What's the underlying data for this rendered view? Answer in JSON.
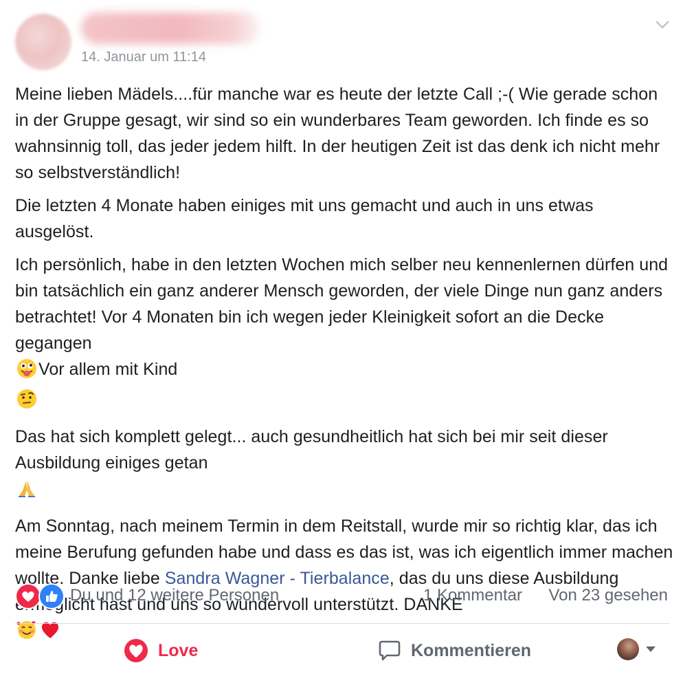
{
  "post": {
    "author_name": "",
    "timestamp": "14. Januar um 11:14",
    "paragraphs": [
      {
        "before": "Meine lieben Mädels....für manche war es heute der letzte Call ;-( Wie gerade schon in der Gruppe gesagt, wir sind so ein wunderbares Team geworden. Ich finde es so wahnsinnig toll, das jeder jedem hilft. In der heutigen Zeit ist das denk ich nicht mehr so selbstverständlich!"
      },
      {
        "before": "Die letzten 4 Monate haben einiges mit uns gemacht und auch in uns etwas ausgelöst."
      },
      {
        "before": "Ich persönlich, habe in den letzten Wochen mich selber neu kennenlernen dürfen und bin tatsächlich ein ganz anderer Mensch geworden, der viele Dinge nun ganz anders betrachtet! Vor 4 Monaten bin ich wegen jeder Kleinigkeit sofort an die Decke gegangen",
        "middle": "Vor allem mit Kind",
        "emoji1": "tongue-out-face-emoji",
        "emoji2": "raised-eyebrow-face-emoji"
      },
      {
        "before": "Das hat sich komplett gelegt... auch gesundheitlich hat sich bei mir seit dieser Ausbildung einiges getan",
        "emoji1": "folded-hands-emoji"
      },
      {
        "before": "Am Sonntag, nach meinem Termin in dem Reitstall, wurde mir so richtig klar, das ich meine Berufung gefunden habe und dass es das ist, was ich eigentlich immer machen wollte. Danke liebe ",
        "mention": "Sandra Wagner - Tierbalance",
        "after": ", das du uns diese Ausbildung ermöglicht hast und uns so wundervoll unterstützt. DANKE",
        "emoji1": "smiling-face-with-hearts-emoji",
        "emoji2": "red-heart-emoji"
      }
    ]
  },
  "reactions": {
    "icons": [
      "love-reaction-icon",
      "like-reaction-icon"
    ],
    "summary": "Du und 12 weitere Personen",
    "comments": "1 Kommentar",
    "seen": "Von 23 gesehen"
  },
  "actions": {
    "love_label": "Love",
    "comment_label": "Kommentieren"
  },
  "colors": {
    "love": "#f0284a",
    "like": "#2e81f8",
    "link": "#385898",
    "secondary_text": "#606770",
    "timestamp": "#90949c"
  }
}
